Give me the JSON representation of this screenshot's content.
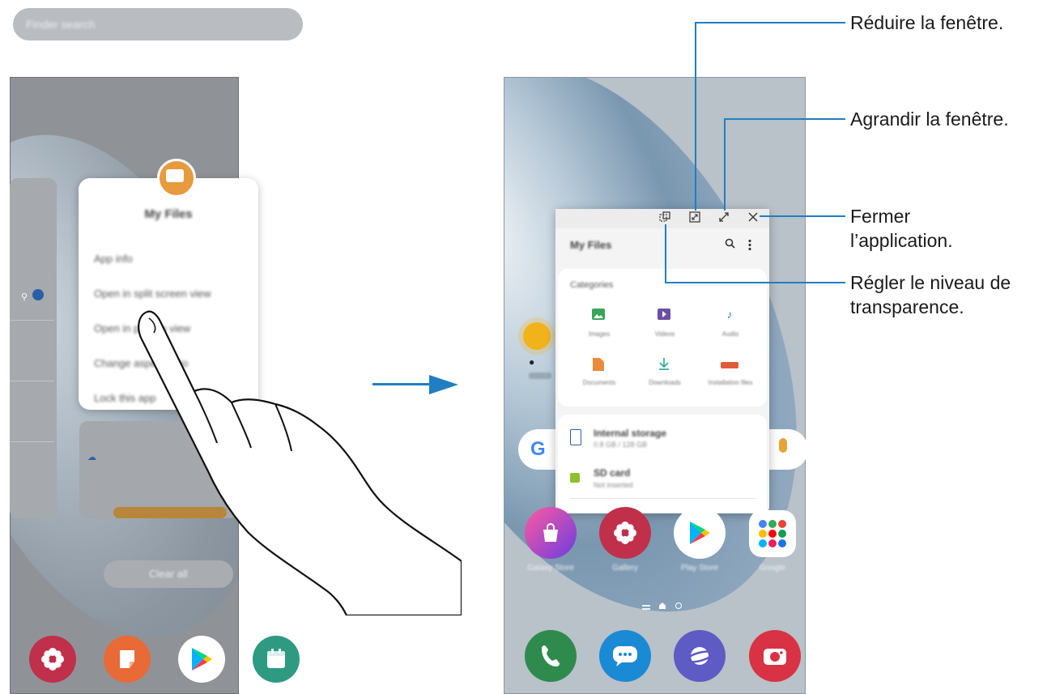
{
  "left_phone": {
    "search_placeholder": "Finder search",
    "app_name": "My Files",
    "menu_items": [
      "App info",
      "Open in split screen view",
      "Open in pop-up view",
      "Change aspect ratio",
      "Lock this app"
    ],
    "clear_all": "Clear all"
  },
  "right_phone": {
    "window_title": "My Files",
    "categories_title": "Categories",
    "categories": [
      {
        "label": "Images",
        "icon": "image-icon",
        "color": "#3aa55a"
      },
      {
        "label": "Videos",
        "icon": "video-icon",
        "color": "#6b4fa3"
      },
      {
        "label": "Audio",
        "icon": "audio-icon",
        "color": "#2a86d0"
      },
      {
        "label": "Documents",
        "icon": "document-icon",
        "color": "#e98b3a"
      },
      {
        "label": "Downloads",
        "icon": "download-icon",
        "color": "#28a7a0"
      },
      {
        "label": "Installation files",
        "icon": "apk-icon",
        "color": "#e05a3a"
      }
    ],
    "storage": [
      {
        "title": "Internal storage",
        "sub": "0.8 GB / 128 GB"
      },
      {
        "title": "SD card",
        "sub": "Not inserted"
      }
    ],
    "apps": [
      "Galaxy Store",
      "Gallery",
      "Play Store",
      "Google"
    ]
  },
  "callouts": {
    "minimize": "Réduire la fenêtre.",
    "maximize": "Agrandir la fenêtre.",
    "close_line1": "Fermer",
    "close_line2": "l’application.",
    "transparency_line1": "Régler le niveau de",
    "transparency_line2": "transparence."
  },
  "colors": {
    "accent": "#1f7fc2"
  }
}
